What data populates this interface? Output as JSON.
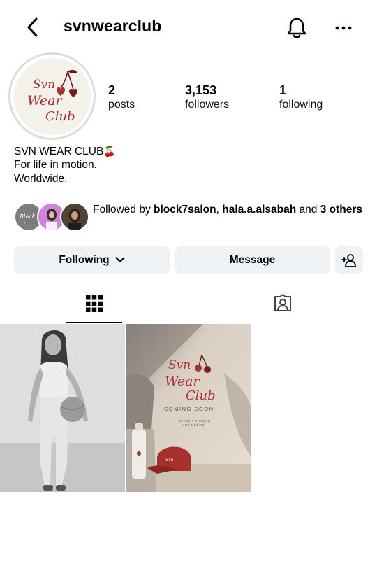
{
  "header": {
    "username": "svnwearclub",
    "back_icon": "chevron-left-icon",
    "notifications_icon": "bell-icon",
    "more_icon": "more-horizontal-icon"
  },
  "profile": {
    "avatar_logo_text": [
      "Svn",
      "Wear",
      "Club"
    ],
    "brand_color": "#a83232",
    "stats": [
      {
        "value": "2",
        "label": "posts"
      },
      {
        "value": "3,153",
        "label": "followers"
      },
      {
        "value": "1",
        "label": "following"
      }
    ],
    "bio": {
      "name": "SVN WEAR CLUB",
      "emoji": "🍒",
      "line2": "For life in motion.",
      "line3": "Worldwide."
    },
    "followed_by": {
      "prefix": "Followed by ",
      "user1": "block7salon",
      "separator": ", ",
      "user2": "hala.a.alsabah",
      "middle": " and ",
      "others": "3 others"
    }
  },
  "actions": {
    "following_label": "Following",
    "message_label": "Message",
    "add_user_icon": "add-person-icon"
  },
  "tabs": {
    "grid_icon": "grid-icon",
    "tagged_icon": "tagged-person-icon",
    "active": "grid"
  },
  "posts": [
    {
      "description_icon": "photo-woman-with-ball"
    },
    {
      "logo_text": [
        "Svn",
        "Wear",
        "Club"
      ],
      "caption": "COMING SOON",
      "subcaption_1": "MADE TO MOVE",
      "subcaption_2": "ANYWHERE"
    }
  ]
}
